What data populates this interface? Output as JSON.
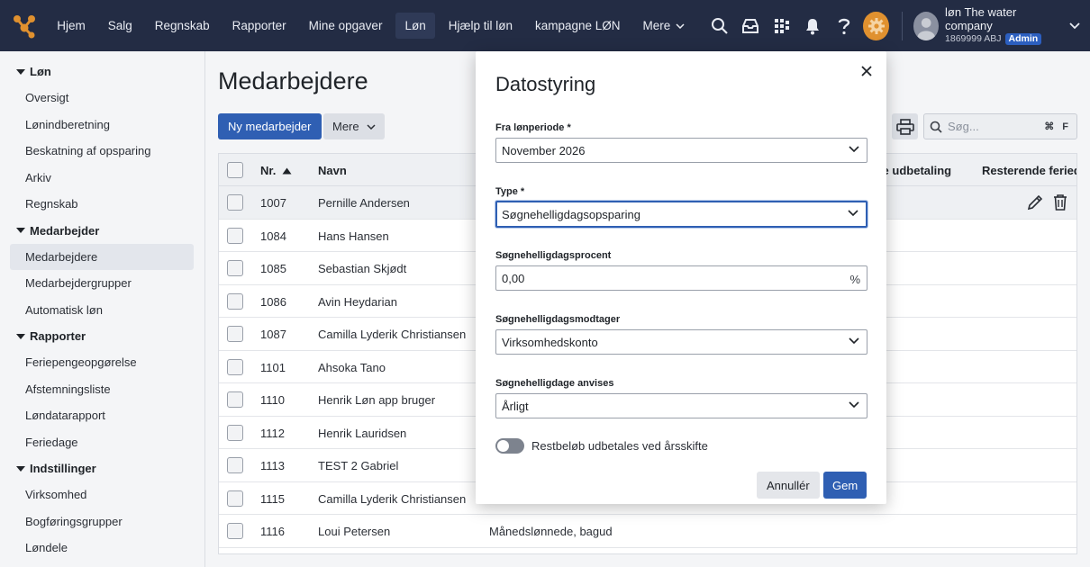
{
  "topbar": {
    "nav": [
      {
        "label": "Hjem"
      },
      {
        "label": "Salg"
      },
      {
        "label": "Regnskab"
      },
      {
        "label": "Rapporter"
      },
      {
        "label": "Mine opgaver"
      },
      {
        "label": "Løn"
      },
      {
        "label": "Hjælp til løn"
      },
      {
        "label": "kampagne LØN"
      }
    ],
    "more_label": "Mere",
    "active_index": 5,
    "user": {
      "name": "løn The water company",
      "account": "1869999 ABJ",
      "role_badge": "Admin"
    },
    "icons": [
      "logo-icon",
      "search-icon",
      "inbox-icon",
      "apps-icon",
      "bell-icon",
      "help-icon",
      "gear-icon",
      "avatar-icon",
      "chevron-down-icon"
    ],
    "accent_color": "#e0912f",
    "bar_color": "#232c44"
  },
  "sidebar": {
    "groups": [
      {
        "label": "Løn",
        "items": [
          "Oversigt",
          "Lønindberetning",
          "Beskatning af opsparing",
          "Arkiv",
          "Regnskab"
        ]
      },
      {
        "label": "Medarbejder",
        "items": [
          "Medarbejdere",
          "Medarbejdergrupper",
          "Automatisk løn"
        ]
      },
      {
        "label": "Rapporter",
        "items": [
          "Feriepengeopgørelse",
          "Afstemningsliste",
          "Løndatarapport",
          "Feriedage"
        ]
      },
      {
        "label": "Indstillinger",
        "items": [
          "Virksomhed",
          "Bogføringsgrupper",
          "Løndele"
        ]
      }
    ],
    "active_item": "Medarbejdere"
  },
  "main": {
    "title": "Medarbejdere",
    "new_button": "Ny medarbejder",
    "more_button": "Mere",
    "search_placeholder": "Søg...",
    "search_shortcut_cmd": "⌘",
    "search_shortcut_key": "F",
    "table": {
      "headers": {
        "nr": "Nr.",
        "name": "Navn",
        "last_payout": "ste udbetaling",
        "remaining": "Resterende feried"
      },
      "rows": [
        {
          "nr": "1007",
          "name": "Pernille Andersen",
          "type": ""
        },
        {
          "nr": "1084",
          "name": "Hans Hansen",
          "type": ""
        },
        {
          "nr": "1085",
          "name": "Sebastian Skjødt",
          "type": ""
        },
        {
          "nr": "1086",
          "name": "Avin Heydarian",
          "type": ""
        },
        {
          "nr": "1087",
          "name": "Camilla Lyderik Christiansen",
          "type": ""
        },
        {
          "nr": "1101",
          "name": "Ahsoka Tano",
          "type": ""
        },
        {
          "nr": "1110",
          "name": "Henrik Løn app bruger",
          "type": ""
        },
        {
          "nr": "1112",
          "name": "Henrik Lauridsen",
          "type": ""
        },
        {
          "nr": "1113",
          "name": "TEST 2 Gabriel",
          "type": ""
        },
        {
          "nr": "1115",
          "name": "Camilla Lyderik Christiansen",
          "type": ""
        },
        {
          "nr": "1116",
          "name": "Loui Petersen",
          "type": "Månedslønnede, bagud"
        }
      ]
    }
  },
  "modal": {
    "title": "Datostyring",
    "fields": {
      "period": {
        "label": "Fra lønperiode *",
        "value": "November 2026"
      },
      "type": {
        "label": "Type *",
        "value": "Søgnehelligdagsopsparing"
      },
      "percent": {
        "label": "Søgnehelligdagsprocent",
        "value": "0,00",
        "suffix": "%"
      },
      "receiver": {
        "label": "Søgnehelligdagsmodtager",
        "value": "Virksomhedskonto"
      },
      "assign": {
        "label": "Søgnehelligdage anvises",
        "value": "Årligt"
      }
    },
    "toggle_label": "Restbeløb udbetales ved årsskifte",
    "toggle_on": false,
    "cancel_label": "Annullér",
    "save_label": "Gem"
  }
}
